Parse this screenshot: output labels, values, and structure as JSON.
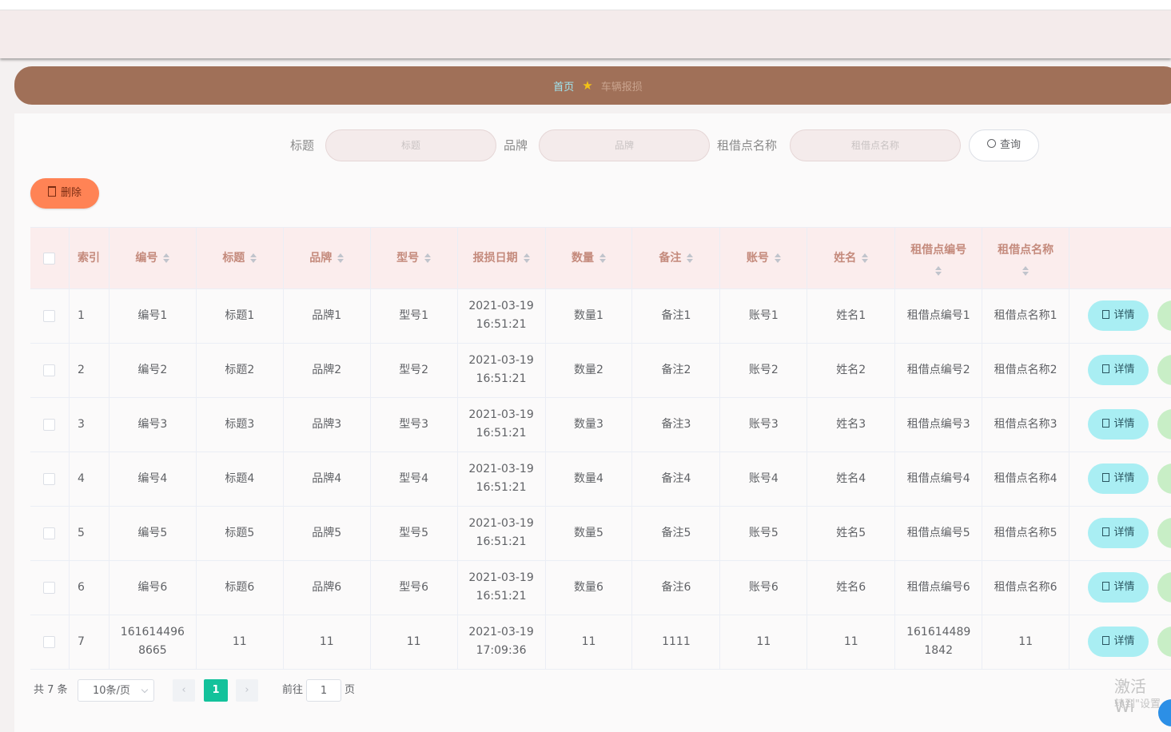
{
  "breadcrumb": {
    "home": "首页",
    "current": "车辆报损"
  },
  "search": {
    "fields": [
      {
        "label": "标题",
        "placeholder": "标题"
      },
      {
        "label": "品牌",
        "placeholder": "品牌"
      },
      {
        "label": "租借点名称",
        "placeholder": "租借点名称"
      }
    ],
    "query_label": "查询"
  },
  "actions": {
    "delete_label": "删除"
  },
  "table": {
    "index_header": "索引",
    "columns": [
      "编号",
      "标题",
      "品牌",
      "型号",
      "报损日期",
      "数量",
      "备注",
      "账号",
      "姓名",
      "租借点编号",
      "租借点名称"
    ],
    "detail_label": "详情",
    "rows": [
      {
        "index": "1",
        "cells": [
          "编号1",
          "标题1",
          "品牌1",
          "型号1",
          "2021-03-19 16:51:21",
          "数量1",
          "备注1",
          "账号1",
          "姓名1",
          "租借点编号1",
          "租借点名称1"
        ]
      },
      {
        "index": "2",
        "cells": [
          "编号2",
          "标题2",
          "品牌2",
          "型号2",
          "2021-03-19 16:51:21",
          "数量2",
          "备注2",
          "账号2",
          "姓名2",
          "租借点编号2",
          "租借点名称2"
        ]
      },
      {
        "index": "3",
        "cells": [
          "编号3",
          "标题3",
          "品牌3",
          "型号3",
          "2021-03-19 16:51:21",
          "数量3",
          "备注3",
          "账号3",
          "姓名3",
          "租借点编号3",
          "租借点名称3"
        ]
      },
      {
        "index": "4",
        "cells": [
          "编号4",
          "标题4",
          "品牌4",
          "型号4",
          "2021-03-19 16:51:21",
          "数量4",
          "备注4",
          "账号4",
          "姓名4",
          "租借点编号4",
          "租借点名称4"
        ]
      },
      {
        "index": "5",
        "cells": [
          "编号5",
          "标题5",
          "品牌5",
          "型号5",
          "2021-03-19 16:51:21",
          "数量5",
          "备注5",
          "账号5",
          "姓名5",
          "租借点编号5",
          "租借点名称5"
        ]
      },
      {
        "index": "6",
        "cells": [
          "编号6",
          "标题6",
          "品牌6",
          "型号6",
          "2021-03-19 16:51:21",
          "数量6",
          "备注6",
          "账号6",
          "姓名6",
          "租借点编号6",
          "租借点名称6"
        ]
      },
      {
        "index": "7",
        "cells": [
          "1616144968665",
          "11",
          "11",
          "11",
          "2021-03-19 17:09:36",
          "11",
          "1111",
          "11",
          "11",
          "1616144891842",
          "11"
        ]
      }
    ]
  },
  "pagination": {
    "total_text": "共 7 条",
    "page_size": "10条/页",
    "current_page": "1",
    "goto_label": "前往",
    "goto_value": "1",
    "page_suffix": "页"
  },
  "watermark": {
    "line1": "激活 Wi",
    "line2": "转到\"设置"
  },
  "colors": {
    "breadcrumb_bg": "#a07058",
    "delete": "#ff8355",
    "detail": "#a9eef3",
    "active_page": "#13c29b",
    "header_text": "#c48a7c"
  }
}
